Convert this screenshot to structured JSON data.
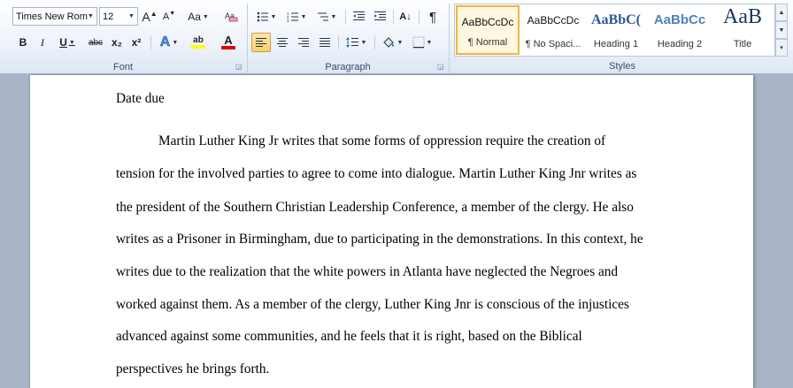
{
  "ribbon": {
    "font": {
      "label": "Font",
      "font_name": "Times New Rom",
      "font_size": "12",
      "grow_icon": "A",
      "shrink_icon": "A",
      "change_case": "Aa",
      "bold": "B",
      "italic": "I",
      "underline": "U",
      "strikethrough": "abc",
      "subscript": "x₂",
      "superscript": "x²",
      "text_effects": "A",
      "font_color": "A",
      "highlight": "ab",
      "highlight_color": "#ffff00",
      "font_color_value": "#e00000"
    },
    "paragraph": {
      "label": "Paragraph",
      "sort": "A↓",
      "show_marks": "¶"
    },
    "styles": {
      "label": "Styles",
      "items": [
        {
          "preview": "AaBbCcDc",
          "name": "¶ Normal"
        },
        {
          "preview": "AaBbCcDc",
          "name": "¶ No Spaci..."
        },
        {
          "preview": "AaBbC(",
          "name": "Heading 1"
        },
        {
          "preview": "AaBbCc",
          "name": "Heading 2"
        },
        {
          "preview": "AaB",
          "name": "Title"
        }
      ]
    }
  },
  "document": {
    "lines": [
      {
        "text": "Date due"
      },
      {
        "text": "Martin Luther King Jr writes that some forms of oppression require the creation of",
        "indent": true
      },
      {
        "text": "tension for the involved parties to agree to come into dialogue. Martin Luther King Jnr writes as"
      },
      {
        "text": "the president of the Southern Christian Leadership Conference, a member of the clergy. He also"
      },
      {
        "text": "writes as a Prisoner in Birmingham, due to participating in the demonstrations. In this context, he"
      },
      {
        "text": "writes due to the realization that the white powers in Atlanta have neglected the Negroes and"
      },
      {
        "text": "worked against them. As a member of the clergy, Luther King Jnr is conscious of the injustices"
      },
      {
        "text": "advanced against some communities, and he feels that it is right, based on the Biblical"
      },
      {
        "text": "perspectives he brings forth."
      }
    ]
  }
}
